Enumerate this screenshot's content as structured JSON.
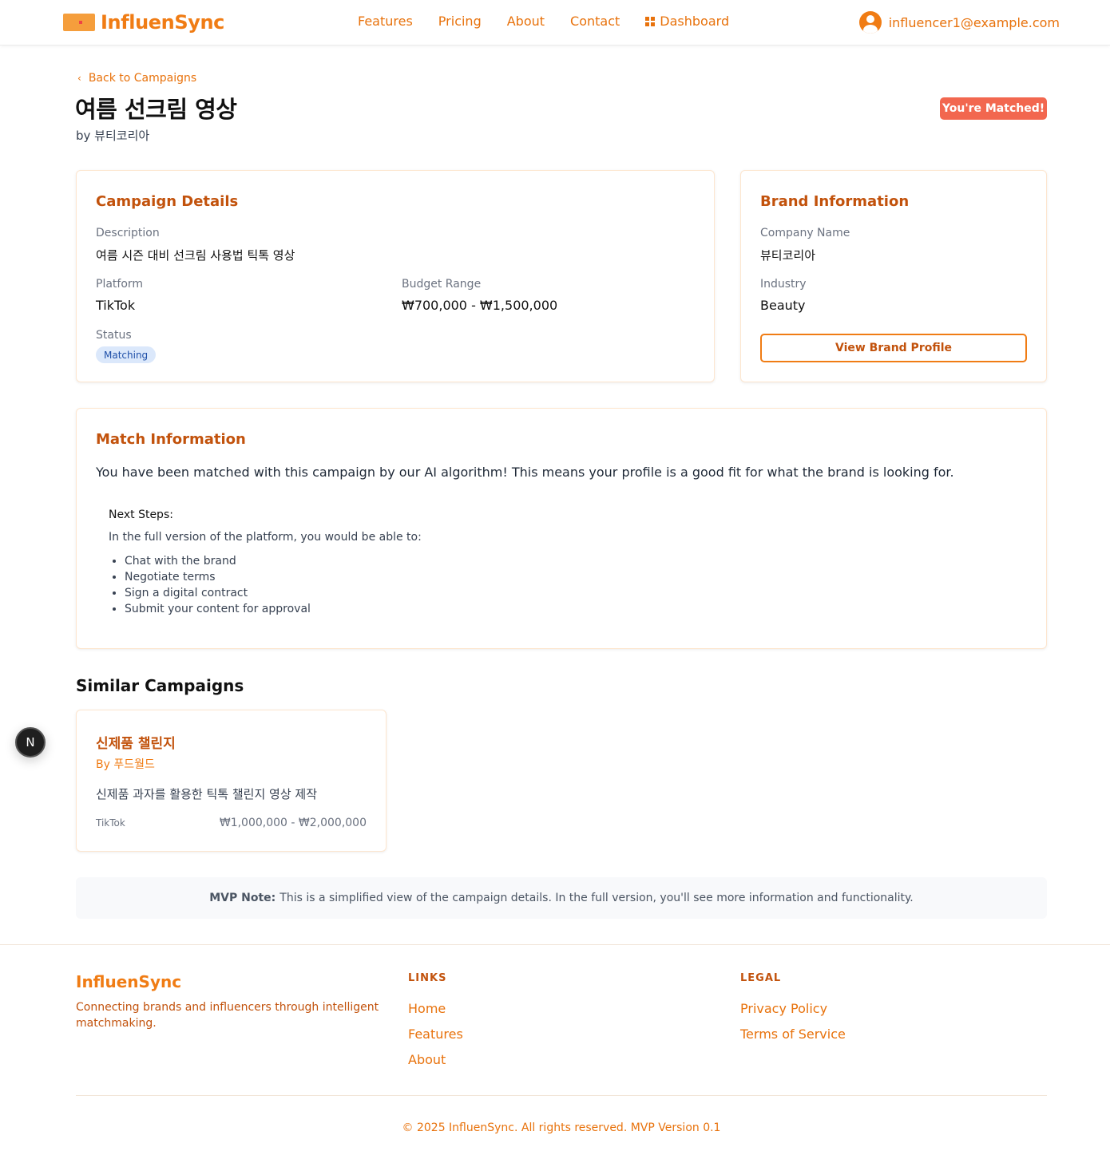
{
  "header": {
    "logo_text": "InfluenSync",
    "nav": [
      "Features",
      "Pricing",
      "About",
      "Contact"
    ],
    "dashboard_label": "Dashboard",
    "user_email": "influencer1@example.com"
  },
  "campaign": {
    "back_label": "Back to Campaigns",
    "title": "여름 선크림 영상",
    "by_line": "by 뷰티코리아",
    "matched_badge": "You're Matched!"
  },
  "details": {
    "title": "Campaign Details",
    "description_label": "Description",
    "description": "여름 시즌 대비 선크림 사용법 틱톡 영상",
    "platform_label": "Platform",
    "platform": "TikTok",
    "budget_label": "Budget Range",
    "budget": "₩700,000 - ₩1,500,000",
    "status_label": "Status",
    "status": "Matching"
  },
  "brand": {
    "title": "Brand Information",
    "company_label": "Company Name",
    "company": "뷰티코리아",
    "industry_label": "Industry",
    "industry": "Beauty",
    "button_label": "View Brand Profile"
  },
  "match": {
    "title": "Match Information",
    "text": "You have been matched with this campaign by our AI algorithm! This means your profile is a good fit for what the brand is looking for.",
    "next_title": "Next Steps:",
    "next_intro": "In the full version of the platform, you would be able to:",
    "steps": [
      "Chat with the brand",
      "Negotiate terms",
      "Sign a digital contract",
      "Submit your content for approval"
    ]
  },
  "similar": {
    "heading": "Similar Campaigns",
    "items": [
      {
        "title": "신제품 챌린지",
        "by": "By 푸드월드",
        "description": "신제품 과자를 활용한 틱톡 챌린지 영상 제작",
        "platform": "TikTok",
        "budget": "₩1,000,000 - ₩2,000,000"
      }
    ]
  },
  "floating_badge": "N",
  "mvp_note": {
    "bold": "MVP Note:",
    "text": "This is a simplified view of the campaign details. In the full version, you'll see more information and functionality."
  },
  "footer": {
    "brand": "InfluenSync",
    "tagline": "Connecting brands and influencers through intelligent matchmaking.",
    "links_heading": "LINKS",
    "links": [
      "Home",
      "Features",
      "About"
    ],
    "legal_heading": "LEGAL",
    "legal": [
      "Privacy Policy",
      "Terms of Service"
    ],
    "copyright": "© 2025 InfluenSync. All rights reserved. MVP Version 0.1"
  },
  "colors": {
    "brand_orange": "#f07c14",
    "heading_orange": "#c2520c",
    "matched_badge": "#f2674f",
    "status_pill_bg": "#dbe8fb"
  }
}
